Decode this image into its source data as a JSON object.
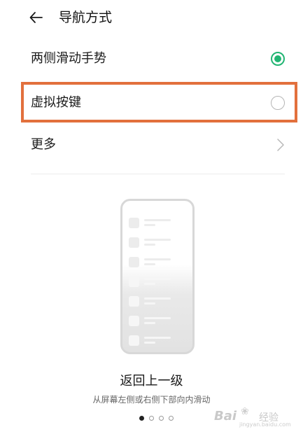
{
  "header": {
    "title": "导航方式",
    "back_icon": "arrow-left-icon"
  },
  "options": [
    {
      "label": "两侧滑动手势",
      "selected": true
    },
    {
      "label": "虚拟按键",
      "selected": false
    }
  ],
  "more": {
    "label": "更多",
    "icon": "chevron-right-icon"
  },
  "gesture": {
    "title": "返回上一级",
    "description": "从屏幕左侧或右侧下部向内滑动",
    "page_indicator": {
      "count": 4,
      "active": 0
    }
  },
  "colors": {
    "accent": "#22b573",
    "highlight": "#e2703d"
  },
  "watermark": {
    "brand": "Bai",
    "brand_cn": "经验",
    "url": "jingyan.baidu.com"
  }
}
